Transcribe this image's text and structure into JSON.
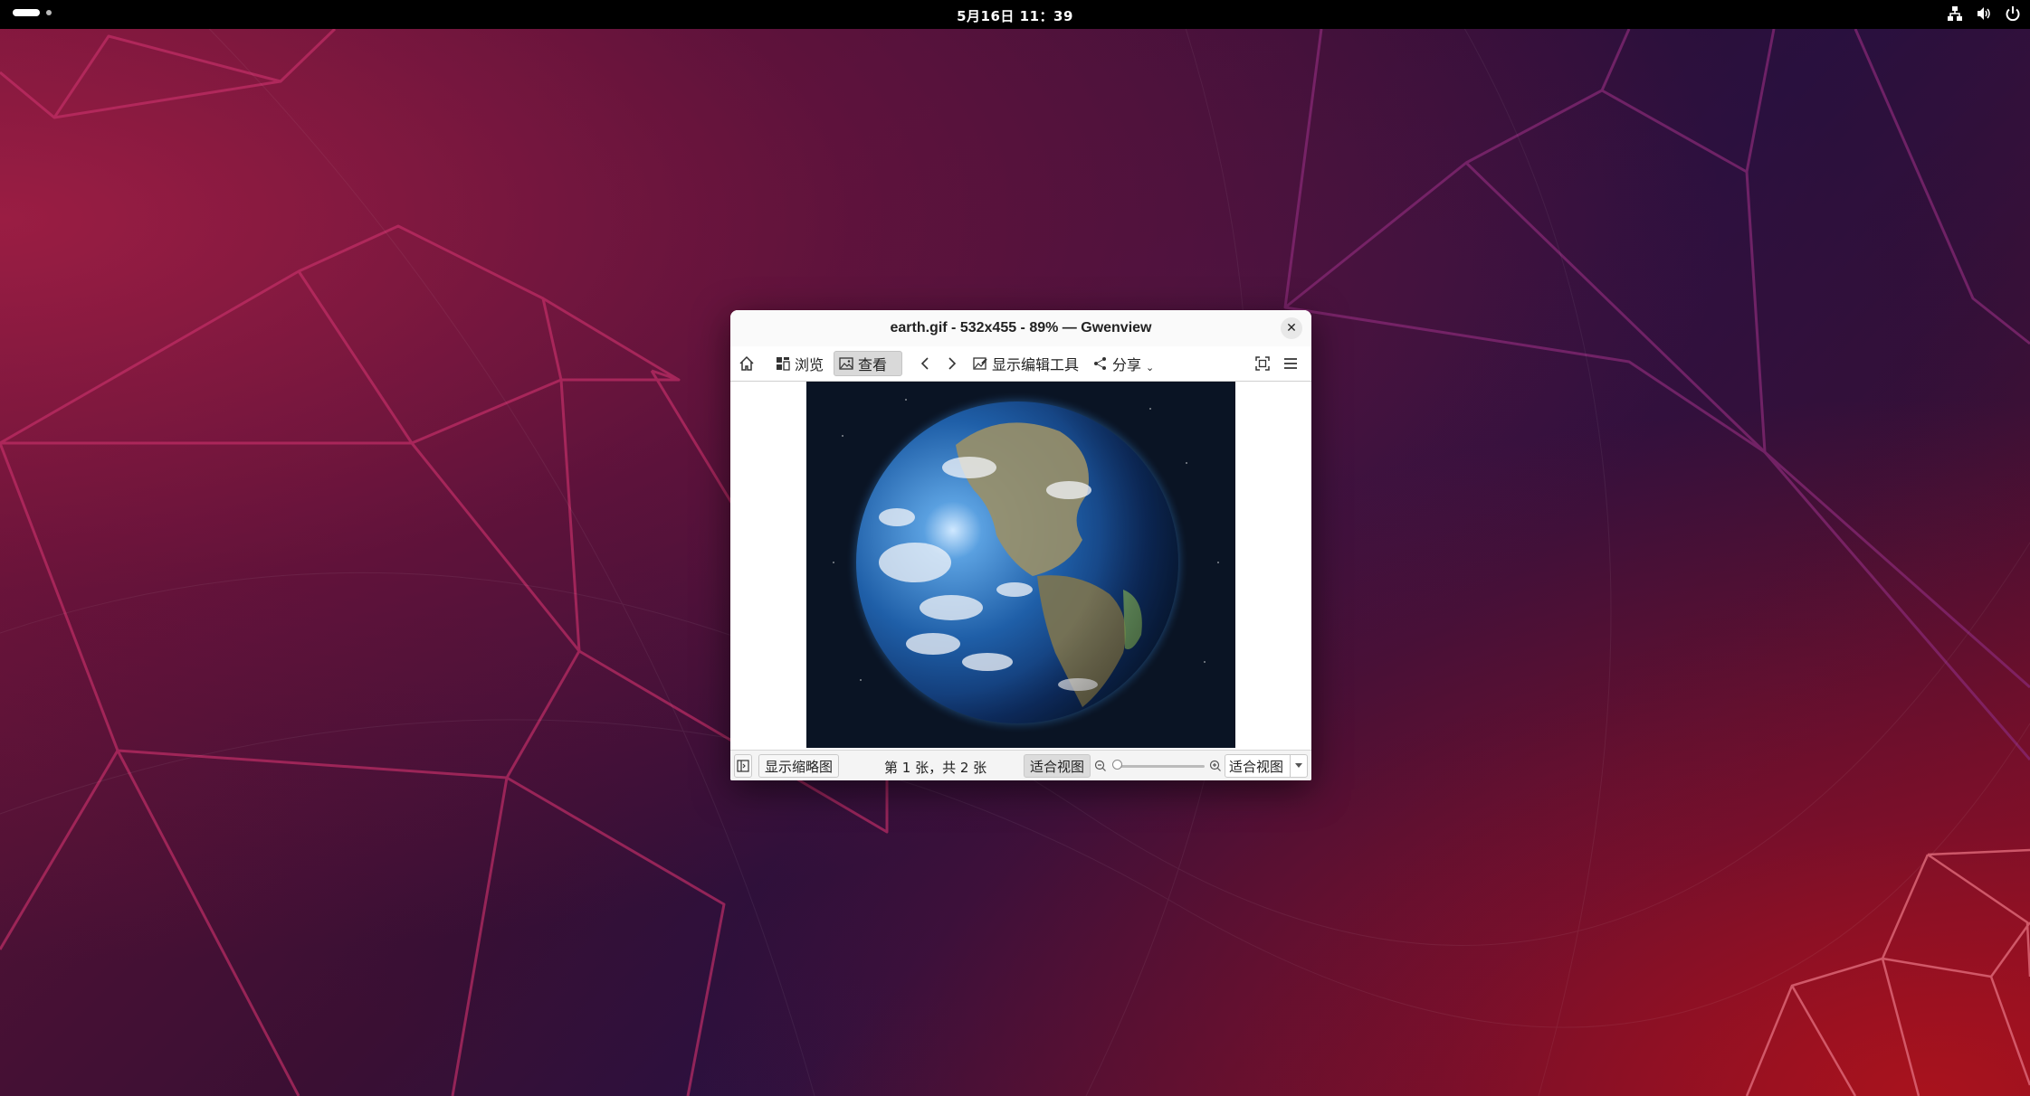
{
  "topbar": {
    "clock": "5月16日  11：39",
    "icons": [
      "activities-pill",
      "network-icon",
      "volume-icon",
      "power-icon"
    ]
  },
  "window": {
    "title": "earth.gif - 532x455 - 89% — Gwenview",
    "close_glyph": "✕",
    "toolbar": {
      "home_icon": "home-icon",
      "browse_label": "浏览",
      "view_label": "查看",
      "prev_icon": "chevron-left-icon",
      "next_icon": "chevron-right-icon",
      "edit_tools_label": "显示编辑工具",
      "share_label": "分享",
      "share_arrow": "⌄",
      "fullscreen_icon": "fullscreen-icon",
      "menu_icon": "hamburger-menu-icon"
    },
    "image": {
      "name": "earth.gif",
      "subject": "earth-globe-image"
    },
    "statusbar": {
      "sidebar_toggle_icon": "sidebar-toggle-icon",
      "thumbnails_label": "显示缩略图",
      "page_info": "第 1 张，共 2 张",
      "fit_label": "适合视图",
      "zoom_combo_value": "适合视图",
      "zoom_slider_fraction": 0.02
    }
  }
}
